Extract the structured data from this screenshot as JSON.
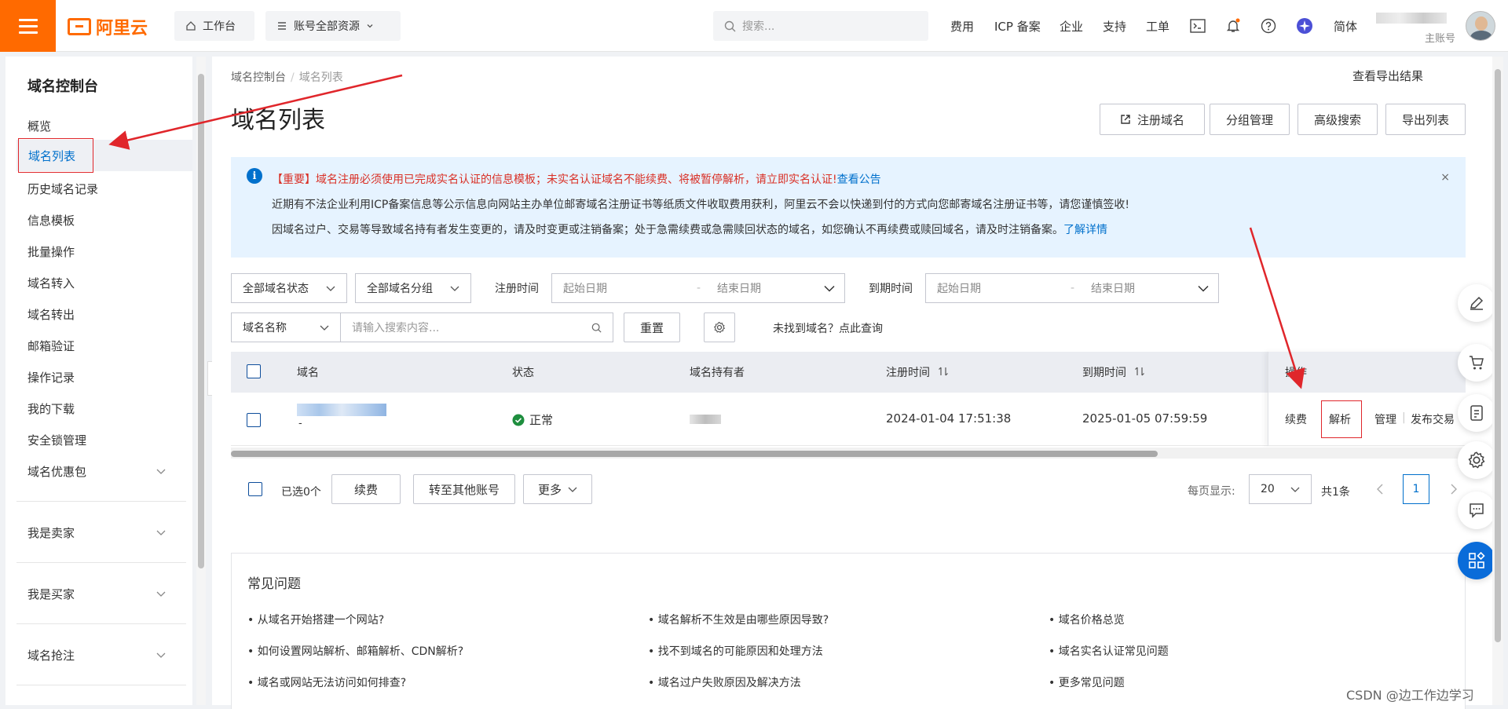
{
  "topbar": {
    "brand": "阿里云",
    "workbench": "工作台",
    "resources": "账号全部资源",
    "search_placeholder": "搜索...",
    "nav": [
      "费用",
      "ICP 备案",
      "企业",
      "支持",
      "工单"
    ],
    "lang": "简体",
    "account_sub": "主账号"
  },
  "sidebar": {
    "title": "域名控制台",
    "items": [
      "概览",
      "域名列表",
      "历史域名记录",
      "信息模板",
      "批量操作",
      "域名转入",
      "域名转出",
      "邮箱验证",
      "操作记录",
      "我的下载",
      "安全锁管理",
      "域名优惠包"
    ],
    "groups": [
      "我是卖家",
      "我是买家",
      "域名抢注"
    ]
  },
  "main": {
    "breadcrumb": [
      "域名控制台",
      "域名列表"
    ],
    "export_result": "查看导出结果",
    "title": "域名列表",
    "actions": [
      "注册域名",
      "分组管理",
      "高级搜索",
      "导出列表"
    ],
    "notice": {
      "line1_red": "【重要】域名注册必须使用已完成实名认证的信息模板；未实名认证域名不能续费、将被暂停解析，请立即实名认证!",
      "line1_link": "查看公告",
      "line2": "近期有不法企业利用ICP备案信息等公示信息向网站主办单位邮寄域名注册证书等纸质文件收取费用获利，阿里云不会以快递到付的方式向您邮寄域名注册证书等，请您谨慎签收!",
      "line3": "因域名过户、交易等导致域名持有者发生变更的，请及时变更或注销备案；处于急需续费或急需赎回状态的域名，如您确认不再续费或赎回域名，请及时注销备案。",
      "line3_link": "了解详情",
      "close": "×"
    },
    "filters": {
      "status": "全部域名状态",
      "group": "全部域名分组",
      "reg_label": "注册时间",
      "exp_label": "到期时间",
      "start_date": "起始日期",
      "end_date": "结束日期",
      "dash": "-",
      "name_field": "域名名称",
      "search_placeholder": "请输入搜索内容...",
      "reset": "重置",
      "not_found": "未找到域名？点此查询"
    },
    "table": {
      "headers": [
        "域名",
        "状态",
        "域名持有者",
        "注册时间",
        "到期时间",
        "操作"
      ],
      "row": {
        "domain_sub": "-",
        "status": "正常",
        "reg_time": "2024-01-04 17:51:38",
        "exp_time": "2025-01-05 07:59:59",
        "ops": [
          "续费",
          "解析",
          "管理",
          "发布交易"
        ]
      }
    },
    "bulk": {
      "selected": "已选0个",
      "renew": "续费",
      "transfer": "转至其他账号",
      "more": "更多"
    },
    "pager": {
      "per_page_label": "每页显示:",
      "per_page": "20",
      "total": "共1条",
      "current": "1"
    },
    "faq": {
      "title": "常见问题",
      "items": [
        "• 从域名开始搭建一个网站?",
        "• 域名解析不生效是由哪些原因导致?",
        "• 域名价格总览",
        "• 如何设置网站解析、邮箱解析、CDN解析?",
        "• 找不到域名的可能原因和处理方法",
        "• 域名实名认证常见问题",
        "• 域名或网站无法访问如何排查?",
        "• 域名过户失败原因及解决方法",
        "• 更多常见问题"
      ]
    }
  },
  "watermark": "CSDN @边工作边学习",
  "colors": {
    "brand": "#ff6a00",
    "link": "#0070cc",
    "annotation": "#e0262b"
  }
}
